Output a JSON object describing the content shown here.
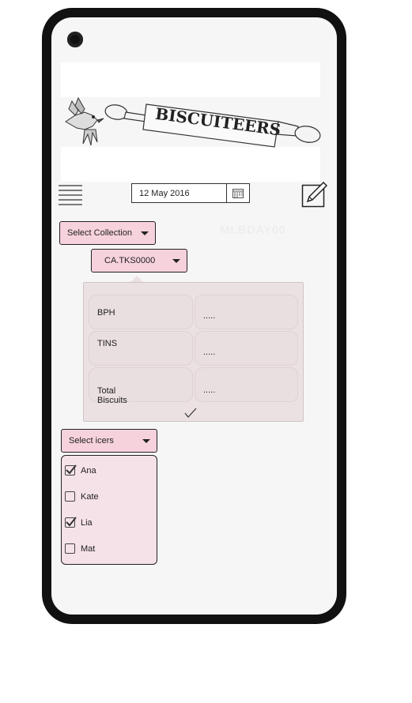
{
  "header": {
    "logo_text": "BISCUITEERS",
    "date": "12 May 2016",
    "order_ref": "MLBDAY00"
  },
  "icons": {
    "menu": "hamburger-menu-icon",
    "calendar": "calendar-icon",
    "edit": "edit-pencil-icon",
    "confirm": "checkmark-icon"
  },
  "collection_select": {
    "label": "Select Collection"
  },
  "code_select": {
    "label": "CA.TKS0000"
  },
  "summary": {
    "rows": [
      {
        "label": "BPH",
        "value": "....."
      },
      {
        "label": "TINS",
        "value": "....."
      },
      {
        "label": "Total\nBiscuits",
        "value": "....."
      }
    ]
  },
  "icers_select": {
    "label": "Select icers"
  },
  "icers": [
    {
      "name": "Ana",
      "checked": true
    },
    {
      "name": "Kate",
      "checked": false
    },
    {
      "name": "Lia",
      "checked": true
    },
    {
      "name": "Mat",
      "checked": false
    }
  ],
  "colors": {
    "accent_pink": "#f6d2dd",
    "panel_bg": "#ebe1e3",
    "device_frame": "#111111"
  }
}
